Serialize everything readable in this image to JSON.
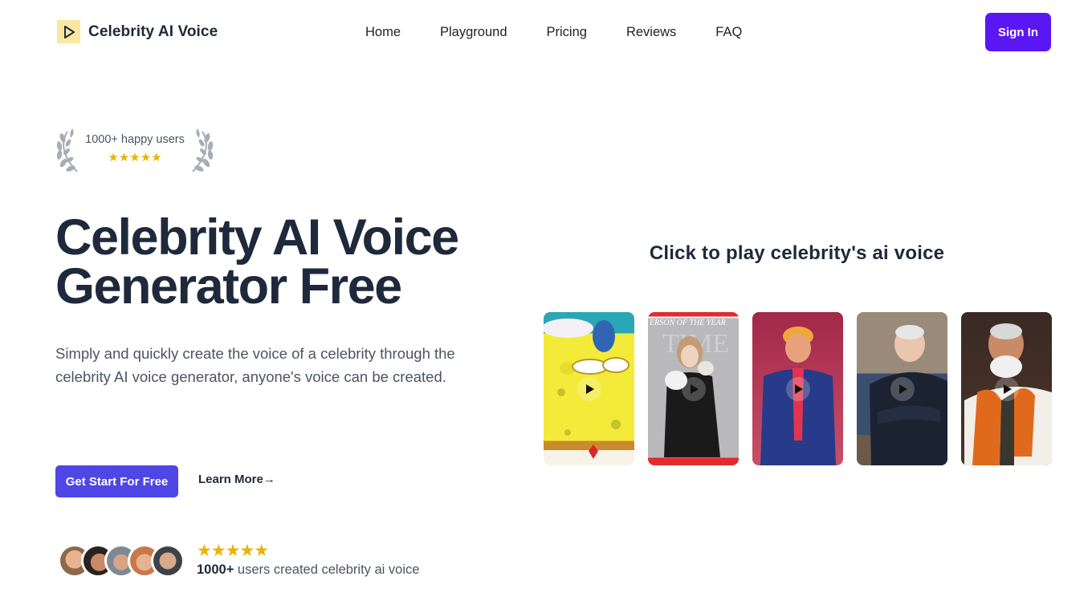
{
  "header": {
    "logo_icon": "play-icon",
    "brand": "Celebrity AI Voice",
    "nav": [
      {
        "label": "Home"
      },
      {
        "label": "Playground"
      },
      {
        "label": "Pricing"
      },
      {
        "label": "Reviews"
      },
      {
        "label": "FAQ"
      }
    ],
    "sign_in": "Sign In"
  },
  "badge": {
    "text": "1000+ happy users",
    "stars": "★★★★★",
    "rating": 5
  },
  "hero": {
    "title_line1": "Celebrity AI Voice",
    "title_line2": "Generator Free",
    "description": "Simply and quickly create the voice of a celebrity through the celebrity AI voice generator, anyone's voice can be created.",
    "cta_label": "Get Start For Free",
    "learn_more": "Learn More→"
  },
  "social_proof": {
    "stars": "★★★★★",
    "rating": 5,
    "count": "1000+",
    "text": " users created celebrity ai voice",
    "avatars": [
      "avatar-1",
      "avatar-2",
      "avatar-3",
      "avatar-4",
      "avatar-5"
    ]
  },
  "voices": {
    "title": "Click to play celebrity's ai voice",
    "cards": [
      {
        "name": "spongebob",
        "icon": "play-icon"
      },
      {
        "name": "magazine-cover",
        "icon": "play-icon"
      },
      {
        "name": "trump",
        "icon": "play-icon"
      },
      {
        "name": "biden",
        "icon": "play-icon"
      },
      {
        "name": "modi",
        "icon": "play-icon"
      }
    ]
  },
  "colors": {
    "primary": "#5b16f4",
    "cta": "#4f46e5",
    "star": "#eab308",
    "logo_bg": "#fbe7a1",
    "heading": "#1e293b"
  }
}
